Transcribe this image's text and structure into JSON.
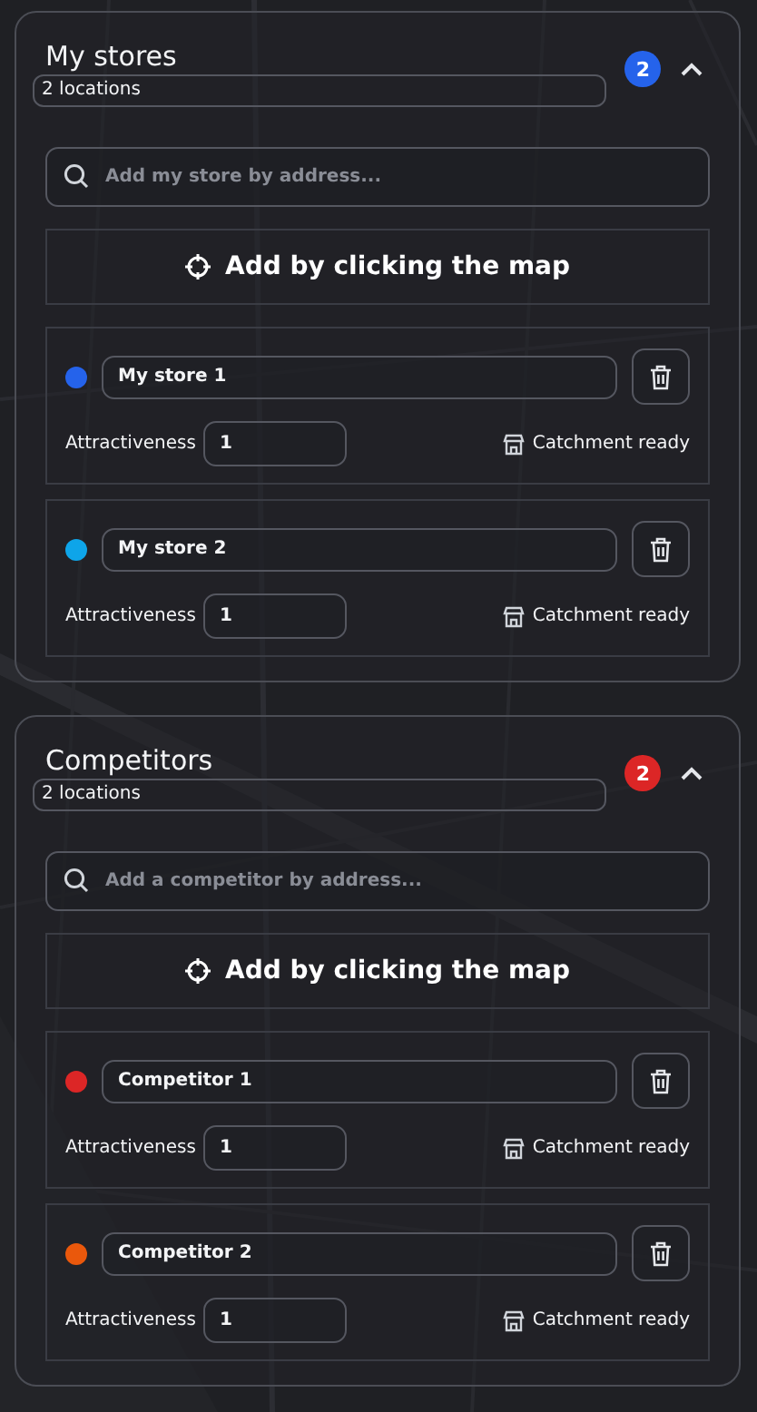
{
  "sections": [
    {
      "title": "My stores",
      "count_label": "2 locations",
      "badge": "2",
      "kind": "own",
      "expanded": true,
      "search": {
        "placeholder": "Add my store by address..."
      },
      "map_button": "Add by clicking the map",
      "items": [
        {
          "name": "My store 1",
          "color": "#2563eb",
          "attr_label": "Attractiveness",
          "attr_value": "1",
          "status": "Catchment ready"
        },
        {
          "name": "My store 2",
          "color": "#0ea5e9",
          "attr_label": "Attractiveness",
          "attr_value": "1",
          "status": "Catchment ready"
        }
      ]
    },
    {
      "title": "Competitors",
      "count_label": "2 locations",
      "badge": "2",
      "kind": "competitor",
      "expanded": true,
      "search": {
        "placeholder": "Add a competitor by address..."
      },
      "map_button": "Add by clicking the map",
      "items": [
        {
          "name": "Competitor 1",
          "color": "#dc2626",
          "attr_label": "Attractiveness",
          "attr_value": "1",
          "status": "Catchment ready"
        },
        {
          "name": "Competitor 2",
          "color": "#ea580c",
          "attr_label": "Attractiveness",
          "attr_value": "1",
          "status": "Catchment ready"
        }
      ]
    }
  ]
}
